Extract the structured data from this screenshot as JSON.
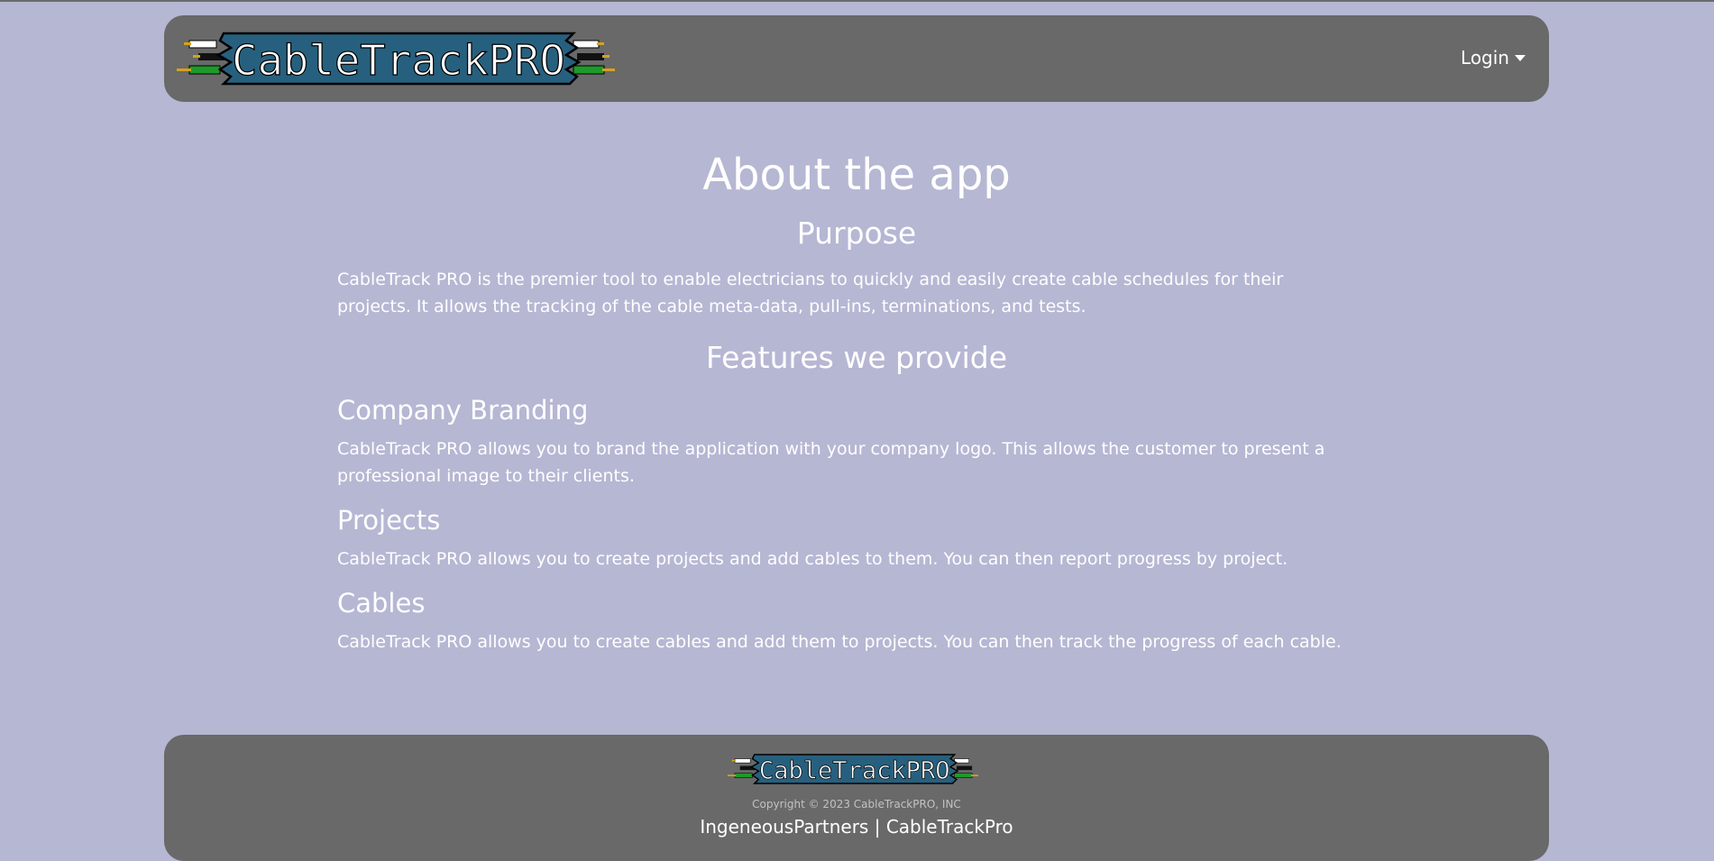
{
  "brand": {
    "logo_text": "CableTrackPRO",
    "colors": {
      "logo_bg": "#27607e",
      "logo_text": "#ffffff",
      "cable_green": "#1e9a2a",
      "cable_black": "#111111",
      "cable_white": "#ffffff",
      "cable_tip": "#d6a21a"
    }
  },
  "nav": {
    "login_label": "Login",
    "login_icon": "caret-down-icon"
  },
  "main": {
    "title": "About the app",
    "purpose_heading": "Purpose",
    "purpose_text": "CableTrack PRO is the premier tool to enable electricians to quickly and easily create cable schedules for their projects. It allows the tracking of the cable meta-data, pull-ins, terminations, and tests.",
    "features_heading": "Features we provide",
    "features": [
      {
        "title": "Company Branding",
        "text": "CableTrack PRO allows you to brand the application with your company logo. This allows the customer to present a professional image to their clients."
      },
      {
        "title": "Projects",
        "text": "CableTrack PRO allows you to create projects and add cables to them. You can then report progress by project."
      },
      {
        "title": "Cables",
        "text": "CableTrack PRO allows you to create cables and add them to projects. You can then track the progress of each cable."
      }
    ]
  },
  "footer": {
    "copyright": "Copyright © 2023 CableTrackPRO, INC",
    "link_1": "IngeneousPartners",
    "separator": "|",
    "link_2": "CableTrackPro"
  },
  "theme": {
    "page_bg": "#b6b7d3",
    "bar_bg": "#686968"
  }
}
